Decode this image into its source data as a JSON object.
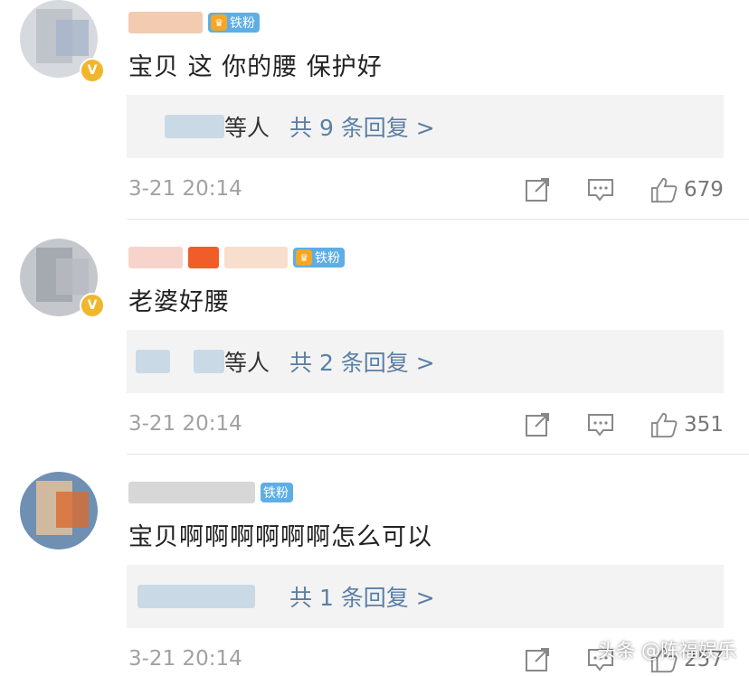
{
  "comments": [
    {
      "fan_badge": "铁粉",
      "text": "宝贝 这 你的腰 保护好",
      "replies_others": "等人",
      "replies_link": "共 9 条回复 >",
      "time": "3-21 20:14",
      "likes": "679"
    },
    {
      "fan_badge": "铁粉",
      "text": "老婆好腰",
      "replies_others": "等人",
      "replies_link": "共 2 条回复 >",
      "time": "3-21 20:14",
      "likes": "351"
    },
    {
      "fan_badge": "铁粉",
      "text": "宝贝啊啊啊啊啊啊怎么可以",
      "replies_others": "",
      "replies_link": "共 1 条回复 >",
      "time": "3-21 20:14",
      "likes": "257"
    }
  ],
  "watermark": "头条 @陈福娱乐",
  "icons": [
    "share-icon",
    "comment-icon",
    "like-icon",
    "verified-badge-icon",
    "crown-icon"
  ],
  "colors": {
    "link": "#5b7fa6",
    "fan_badge": "#5eaee6",
    "verified": "#f2b62b",
    "meta": "#a1a1a1"
  }
}
